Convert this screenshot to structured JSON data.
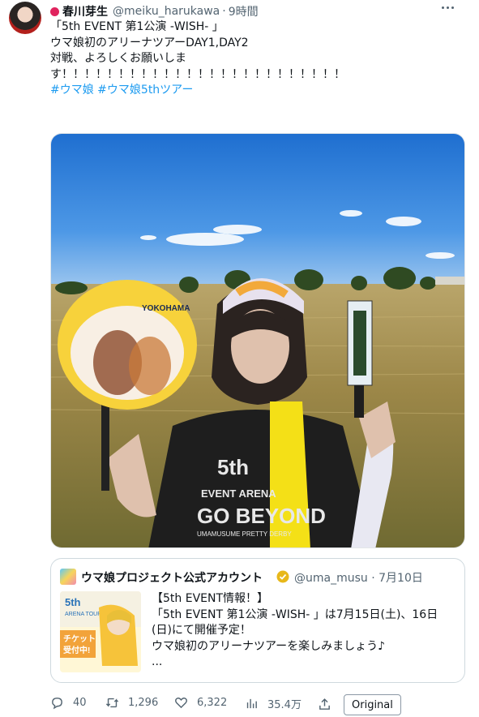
{
  "tweet": {
    "display_name": "春川芽生",
    "handle": "@meiku_harukawa",
    "separator": "·",
    "time": "9時間",
    "lines": [
      "「5th EVENT 第1公演 -WISH- 」",
      "ウマ娘初のアリーナツアーDAY1,DAY2",
      "",
      "対戦、よろしくお願いしま",
      "す！！！！！！！！！！！！！！！！！！！！！！！！！"
    ],
    "hashtags": "#ウマ娘 #ウマ娘5thツアー"
  },
  "photo": {
    "fan_text_top": "YOKOHAMA",
    "shirt_text_1": "5th",
    "shirt_text_2": "EVENT ARENA",
    "shirt_text_3": "GO BEYOND",
    "shirt_text_4": "UMAMUSUME PRETTY DERBY"
  },
  "quote": {
    "display_name": "ウマ娘プロジェクト公式アカウント",
    "handle": "@uma_musu",
    "separator": "·",
    "date": "7月10日",
    "thumb_line1": "5th",
    "thumb_line2": "ARENA TOUR",
    "thumb_ticket_1": "チケット",
    "thumb_ticket_2": "受付中!",
    "lines": [
      "【5th EVENT情報！】",
      "「5th EVENT 第1公演 -WISH- 」は7月15日(土)、16日",
      "(日)にて開催予定！",
      "ウマ娘初のアリーナツアーを楽しみましょう♪",
      "..."
    ]
  },
  "actions": {
    "replies": "40",
    "retweets": "1,296",
    "likes": "6,322",
    "views": "35.4万",
    "original_label": "Original"
  }
}
